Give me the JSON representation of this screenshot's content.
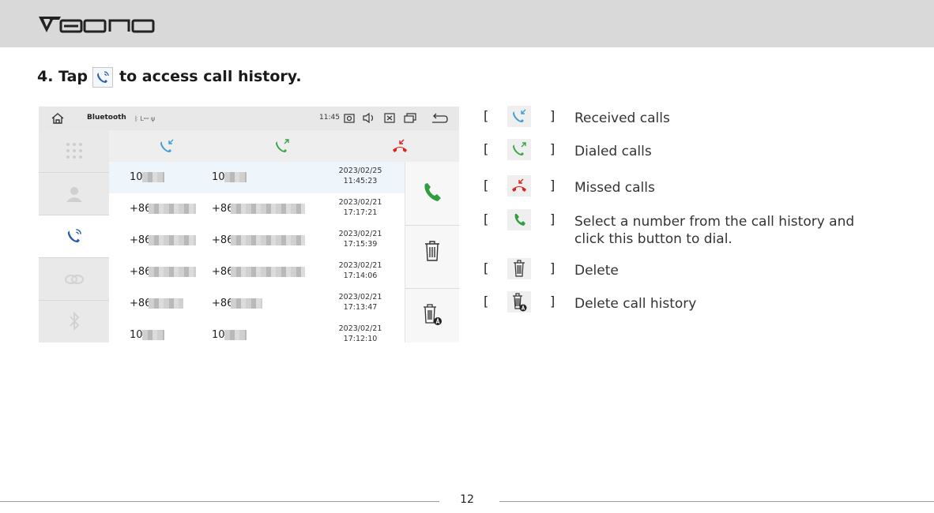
{
  "header": {
    "brand": "Eonon"
  },
  "step": {
    "before": "4. Tap",
    "after": "to access call history."
  },
  "device": {
    "status_title": "Bluetooth",
    "status_signal": "ᛒ Lꟷ ψ",
    "status_time": "11:45",
    "rows": [
      {
        "name": "10",
        "number": "10",
        "date": "2023/02/25",
        "time": "11:45:23"
      },
      {
        "name": "+86",
        "number": "+86",
        "date": "2023/02/21",
        "time": "17:17:21"
      },
      {
        "name": "+86",
        "number": "+86",
        "date": "2023/02/21",
        "time": "17:15:39"
      },
      {
        "name": "+86",
        "number": "+86",
        "date": "2023/02/21",
        "time": "17:14:06"
      },
      {
        "name": "+86",
        "number": "+86",
        "date": "2023/02/21",
        "time": "17:13:47"
      },
      {
        "name": "10",
        "number": "10",
        "date": "2023/02/21",
        "time": "17:12:10"
      }
    ]
  },
  "legend": [
    {
      "icon": "received-call-icon",
      "text": "Received calls"
    },
    {
      "icon": "dialed-call-icon",
      "text": "Dialed calls"
    },
    {
      "icon": "missed-call-icon",
      "text": "Missed calls"
    },
    {
      "icon": "dial-icon",
      "text": "Select a number from the call history and click this button to dial."
    },
    {
      "icon": "delete-icon",
      "text": "Delete"
    },
    {
      "icon": "delete-all-icon",
      "text": "Delete call history"
    }
  ],
  "legend_brackets": {
    "open": "[",
    "close": "]"
  },
  "page": {
    "number": "12"
  },
  "colors": {
    "header_bg": "#d9d9d9",
    "received": "#3a9fd6",
    "dialed": "#3aa54a",
    "missed": "#e0201b",
    "dial": "#2e9e3e"
  }
}
